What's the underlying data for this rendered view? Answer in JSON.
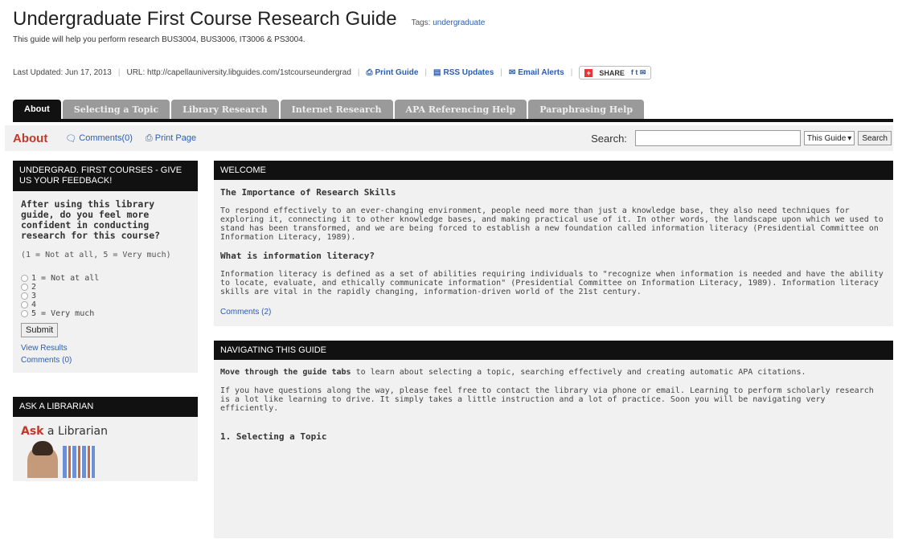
{
  "header": {
    "title": "Undergraduate First Course Research Guide",
    "tags_label": "Tags:",
    "tags_value": "undergraduate",
    "description": "This guide will help you perform research BUS3004, BUS3006, IT3006 & PS3004."
  },
  "meta": {
    "last_updated": "Last Updated: Jun 17, 2013",
    "url": "URL: http://capellauniversity.libguides.com/1stcourseundergrad",
    "print_guide": "Print Guide",
    "rss": "RSS Updates",
    "email": "Email Alerts",
    "share": "SHARE"
  },
  "tabs": [
    {
      "label": "About"
    },
    {
      "label": "Selecting a Topic"
    },
    {
      "label": "Library Research"
    },
    {
      "label": "Internet Research"
    },
    {
      "label": "APA Referencing Help"
    },
    {
      "label": "Paraphrasing Help"
    }
  ],
  "subbar": {
    "title": "About",
    "comments": "Comments(0)",
    "print_page": "Print Page",
    "search_label": "Search:",
    "search_value": "",
    "scope": "This Guide",
    "search_button": "Search"
  },
  "feedback": {
    "heading": "UNDERGRAD. FIRST COURSES - GIVE US YOUR FEEDBACK!",
    "question": "After using this library guide, do you feel more confident in conducting research for this course?",
    "scale": "(1 = Not at all, 5 = Very much)",
    "options": [
      "1 = Not at all",
      "2",
      "3",
      "4",
      "5 = Very much"
    ],
    "submit": "Submit",
    "view_results": "View Results",
    "comments": "Comments (0)"
  },
  "ask": {
    "heading": "ASK A LIBRARIAN",
    "title_bold": "Ask",
    "title_rest": " a Librarian"
  },
  "welcome": {
    "heading": "WELCOME",
    "h1": "The Importance of Research Skills",
    "p1": "To respond effectively to an ever-changing environment, people need more than just a knowledge base, they also need techniques for exploring it, connecting it to other knowledge bases, and making practical use of it. In other words, the landscape upon which we used to stand has been transformed, and we are being forced to establish a new foundation called information literacy (Presidential Committee on Information Literacy, 1989).",
    "h2": "What is information literacy?",
    "p2": "Information literacy is defined as a set of abilities requiring individuals to \"recognize when information is needed and have the ability to locate, evaluate, and ethically communicate information\" (Presidential Committee on Information Literacy, 1989). Information literacy skills are vital in the rapidly changing, information-driven world of the 21st century.",
    "comments": "Comments (2)"
  },
  "navigating": {
    "heading": "NAVIGATING THIS GUIDE",
    "lead_bold": "Move through the guide tabs",
    "lead_rest": " to learn about selecting a topic, searching effectively and creating automatic APA citations.",
    "p1": "If you have questions along the way, please feel free to contact the library via phone or email.  Learning to perform scholarly research is a lot like learning to drive.  It simply takes a little instruction and a lot of practice.  Soon you will be navigating very efficiently.",
    "item1": "1.  Selecting a Topic"
  }
}
